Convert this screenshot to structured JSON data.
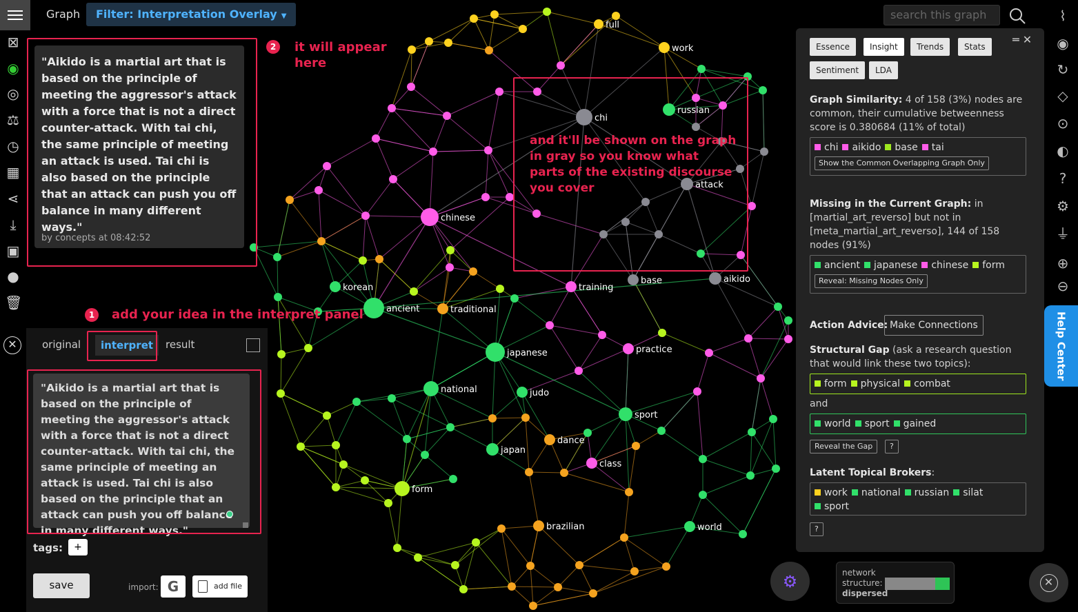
{
  "header": {
    "graph_tab": "Graph",
    "filter_label": "Filter: Interpretation Overlay",
    "search_placeholder": "search this graph"
  },
  "quote": {
    "text": "\"Aikido is a martial art that is based on the principle of meeting the aggressor's attack with a force that is not a direct counter-attack. With tai chi, the same principle of meeting an attack is used. Tai chi is also based on the principle that an attack can push you off balance in many different ways.\"",
    "meta": "by concepts at 08:42:52"
  },
  "annotations": {
    "a1_num": "1",
    "a1_text": "add your idea in the interpret panel",
    "a2_num": "2",
    "a2_text": "it will appear here",
    "a3_text": "and it'll be shown on the graph in gray so you know what parts of the existing discourse you cover",
    "color": "#e8234f"
  },
  "panel": {
    "tabs": [
      "original",
      "interpret",
      "result"
    ],
    "active_tab": "interpret",
    "textarea_value": "\"Aikido is a martial art that is based on the principle of meeting the aggressor's attack with a force that is not a direct counter-attack. With tai chi, the same principle of meeting an attack is used. Tai chi is also based on the principle that an attack can push you off balance in many different ways.\"",
    "tags_label": "tags:",
    "add_tag": "+",
    "save_label": "save",
    "import_label": "import:",
    "google_label": "G",
    "add_file_label": "add file"
  },
  "right_panel": {
    "buttons": [
      "Essence",
      "Insight",
      "Trends",
      "Stats",
      "Sentiment",
      "LDA"
    ],
    "selected": "Insight",
    "similarity_title": "Graph Similarity:",
    "similarity_text": "4 of 158 (3%) nodes are common, their cumulative betweenness score is 0.380684 (11% of total)",
    "common_nodes": [
      {
        "label": "chi",
        "color": "#ff5ce8"
      },
      {
        "label": "aikido",
        "color": "#ff5ce8"
      },
      {
        "label": "base",
        "color": "#9fe81f"
      },
      {
        "label": "tai",
        "color": "#ff5ce8"
      }
    ],
    "common_btn": "Show the Common Overlapping Graph Only",
    "missing_title": "Missing in the Current Graph:",
    "missing_text": "in [martial_art_reverso] but not in [meta_martial_art_reverso], 144 of 158 nodes (91%)",
    "missing_nodes": [
      {
        "label": "ancient",
        "color": "#31e06a"
      },
      {
        "label": "japanese",
        "color": "#31e06a"
      },
      {
        "label": "chinese",
        "color": "#ff5ce8"
      },
      {
        "label": "form",
        "color": "#b7f51f"
      }
    ],
    "missing_btn": "Reveal: Missing Nodes Only",
    "advice_label": "Action Advice:",
    "advice_btn": "Make Connections",
    "gap_title": "Structural Gap",
    "gap_text": "(ask a research question that would link these two topics):",
    "gap_a": [
      {
        "label": "form",
        "color": "#b7f51f"
      },
      {
        "label": "physical",
        "color": "#b7f51f"
      },
      {
        "label": "combat",
        "color": "#b7f51f"
      }
    ],
    "gap_and": "and",
    "gap_b": [
      {
        "label": "world",
        "color": "#31e06a"
      },
      {
        "label": "sport",
        "color": "#31e06a"
      },
      {
        "label": "gained",
        "color": "#31e06a"
      }
    ],
    "reveal_gap_btn": "Reveal the Gap",
    "help_q": "?",
    "brokers_title": "Latent Topical Brokers",
    "brokers_colon": ":",
    "brokers": [
      {
        "label": "work",
        "color": "#ffd21f"
      },
      {
        "label": "national",
        "color": "#31e06a"
      },
      {
        "label": "russian",
        "color": "#31e06a"
      },
      {
        "label": "silat",
        "color": "#31e06a"
      },
      {
        "label": "sport",
        "color": "#31e06a"
      }
    ],
    "brokers_help": "?"
  },
  "help_center": "Help Center",
  "network": {
    "label_line1": "network",
    "label_line2": "structure:",
    "status": "dispersed",
    "level": 0.22
  },
  "graph_labels": [
    "full",
    "work",
    "russian",
    "chi",
    "attack",
    "chinese",
    "korean",
    "ancient",
    "traditional",
    "training",
    "base",
    "aikido",
    "japanese",
    "practice",
    "national",
    "judo",
    "sport",
    "dance",
    "japan",
    "class",
    "form",
    "brazilian",
    "world"
  ],
  "colors": {
    "pink": "#ff5ce8",
    "green": "#31e06a",
    "lime": "#b7f51f",
    "orange": "#f5a31f",
    "yellow": "#ffd21f",
    "gray": "#8a8a92",
    "accent": "#4fb3ff"
  }
}
